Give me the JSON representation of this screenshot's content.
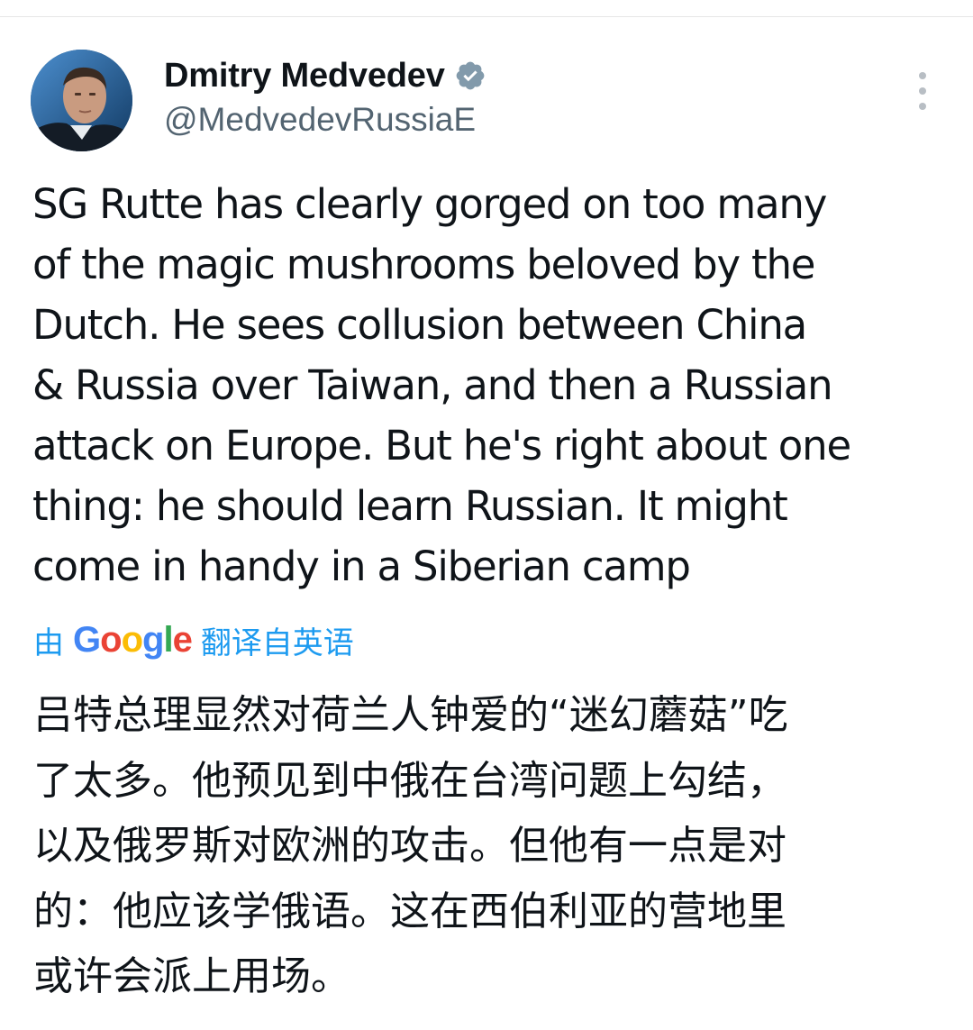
{
  "author": {
    "display_name": "Dmitry Medvedev",
    "handle": "@MedvedevRussiaE",
    "verified": true
  },
  "icons": {
    "verified": "verified-badge-icon",
    "more": "more-options-icon",
    "avatar": "profile-photo"
  },
  "tweet": {
    "text": "SG Rutte has clearly gorged on too many\nof the magic mushrooms beloved by the\nDutch. He sees collusion between China\n& Russia over Taiwan, and then a Russian\nattack on Europe. But he's right about one\nthing: he should learn Russian. It might\ncome in handy in a Siberian camp"
  },
  "translation": {
    "prefix": "由",
    "provider": "Google",
    "suffix": "翻译自英语",
    "text": "吕特总理显然对荷兰人钟爱的“迷幻蘑菇”吃\n了太多。他预见到中俄在台湾问题上勾结，\n以及俄罗斯对欧洲的攻击。但他有一点是对\n的：他应该学俄语。这在西伯利亚的营地里\n或许会派上用场。"
  },
  "colors": {
    "text_primary": "#0f1419",
    "text_secondary": "#536471",
    "link_blue": "#1d9bf0",
    "verified_badge": "#829aab"
  }
}
